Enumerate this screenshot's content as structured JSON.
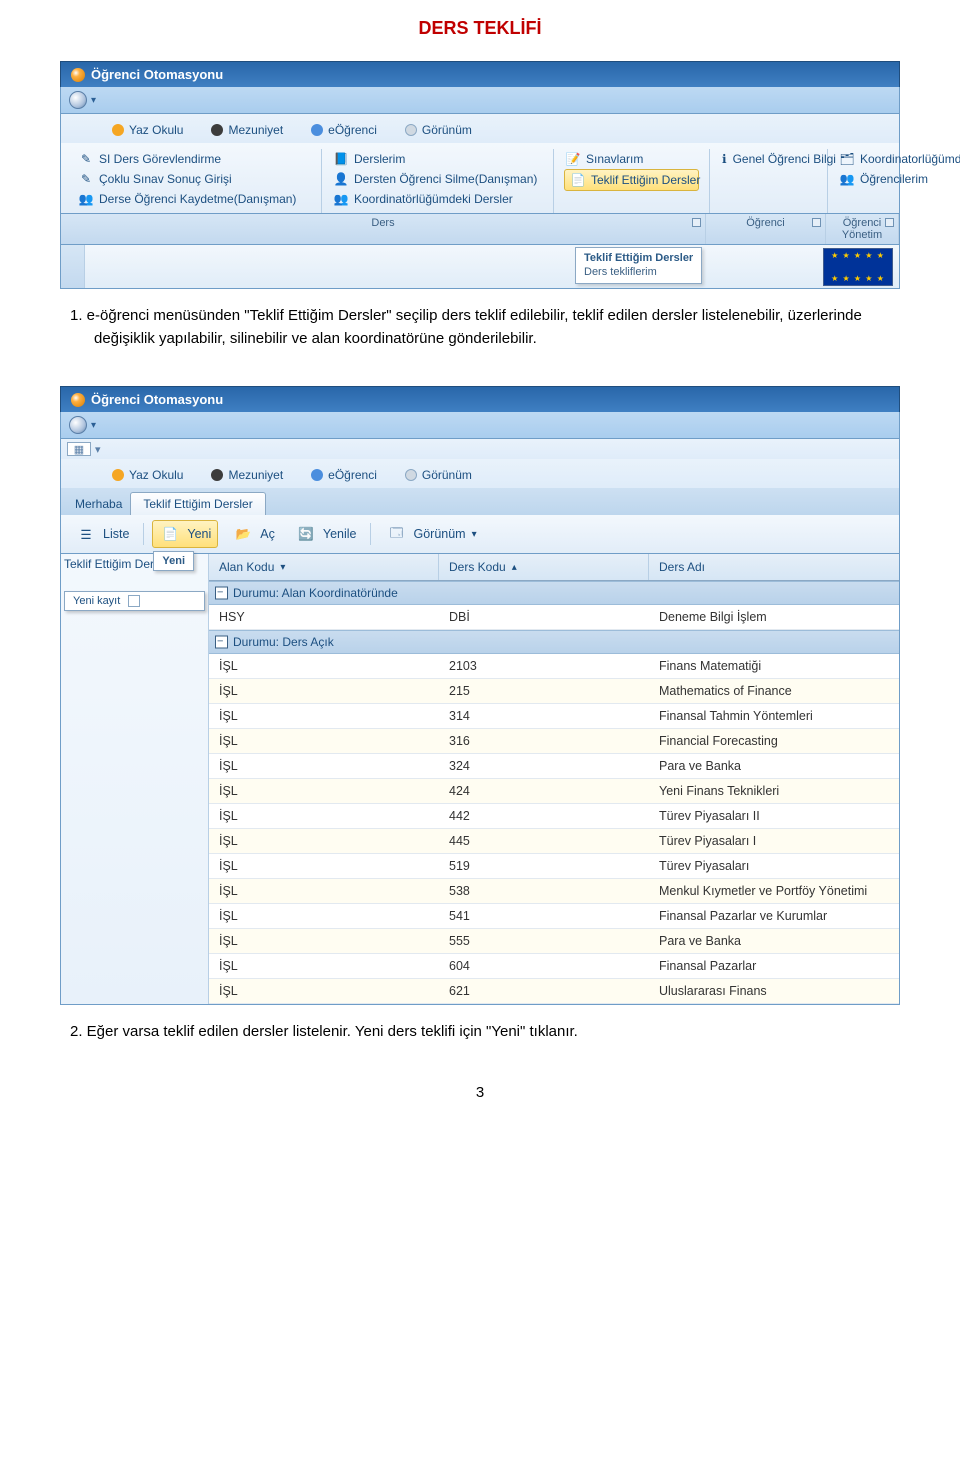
{
  "doc_title": "DERS TEKLİFİ",
  "app_title": "Öğrenci Otomasyonu",
  "shot1": {
    "tabs": [
      {
        "label": "Yaz Okulu",
        "color": "#f5a623"
      },
      {
        "label": "Mezuniyet",
        "color": "#3c3c3c"
      },
      {
        "label": "eÖğrenci",
        "color": "#4b8ede"
      },
      {
        "label": "Görünüm",
        "color": "#d0d9e2"
      }
    ],
    "groups": {
      "ders": [
        "SI Ders Görevlendirme",
        "Çoklu Sınav Sonuç Girişi",
        "Derse Öğrenci Kaydetme(Danışman)"
      ],
      "ders2": [
        "Derslerim",
        "Dersten Öğrenci Silme(Danışman)",
        "Koordinatörlüğümdeki Dersler"
      ],
      "mid": [
        "Sınavlarım",
        "Teklif Ettiğim Dersler"
      ],
      "ogr": [
        "Genel Öğrenci Bilgi"
      ],
      "yon": [
        "Koordinatorlüğümdeki Program(lar)",
        "Öğrencilerim"
      ]
    },
    "group_labels": [
      "Ders",
      "Öğrenci",
      "Öğrenci Yönetim"
    ],
    "tooltip": {
      "title": "Teklif Ettiğim Dersler",
      "sub": "Ders tekliflerim"
    }
  },
  "explain1": "1.   e-öğrenci  menüsünden \"Teklif Ettiğim Dersler\" seçilip ders teklif edilebilir, teklif edilen dersler listelenebilir,  üzerlerinde değişiklik yapılabilir, silinebilir ve alan koordinatörüne gönderilebilir.",
  "shot2": {
    "tabs": [
      {
        "label": "Yaz Okulu",
        "color": "#f5a623"
      },
      {
        "label": "Mezuniyet",
        "color": "#3c3c3c"
      },
      {
        "label": "eÖğrenci",
        "color": "#4b8ede"
      },
      {
        "label": "Görünüm",
        "color": "#d0d9e2"
      }
    ],
    "hello": "Merhaba",
    "active_tab": "Teklif Ettiğim Dersler",
    "toolbar": {
      "liste": "Liste",
      "yeni": "Yeni",
      "ac": "Aç",
      "yenile": "Yenile",
      "gorunum": "Görünüm"
    },
    "tree_label": "Teklif Ettiğim Derle",
    "popup": {
      "title": "Yeni",
      "sub": "Yeni kayıt"
    },
    "columns": {
      "alan": "Alan Kodu",
      "ders": "Ders Kodu",
      "adi": "Ders Adı"
    },
    "groups": [
      {
        "title": "Durumu: Alan Koordinatöründe",
        "rows": [
          {
            "alan": "HSY",
            "kod": "DBİ",
            "adi": "Deneme Bilgi İşlem"
          }
        ]
      },
      {
        "title": "Durumu: Ders Açık",
        "rows": [
          {
            "alan": "İŞL",
            "kod": "2103",
            "adi": "Finans Matematiği"
          },
          {
            "alan": "İŞL",
            "kod": "215",
            "adi": "Mathematics of Finance"
          },
          {
            "alan": "İŞL",
            "kod": "314",
            "adi": "Finansal Tahmin Yöntemleri"
          },
          {
            "alan": "İŞL",
            "kod": "316",
            "adi": "Financial Forecasting"
          },
          {
            "alan": "İŞL",
            "kod": "324",
            "adi": "Para ve Banka"
          },
          {
            "alan": "İŞL",
            "kod": "424",
            "adi": "Yeni Finans Teknikleri"
          },
          {
            "alan": "İŞL",
            "kod": "442",
            "adi": "Türev Piyasaları II"
          },
          {
            "alan": "İŞL",
            "kod": "445",
            "adi": "Türev Piyasaları I"
          },
          {
            "alan": "İŞL",
            "kod": "519",
            "adi": "Türev Piyasaları"
          },
          {
            "alan": "İŞL",
            "kod": "538",
            "adi": "Menkul Kıymetler ve Portföy Yönetimi"
          },
          {
            "alan": "İŞL",
            "kod": "541",
            "adi": "Finansal Pazarlar ve Kurumlar"
          },
          {
            "alan": "İŞL",
            "kod": "555",
            "adi": "Para ve Banka"
          },
          {
            "alan": "İŞL",
            "kod": "604",
            "adi": "Finansal Pazarlar"
          },
          {
            "alan": "İŞL",
            "kod": "621",
            "adi": "Uluslararası Finans"
          }
        ]
      }
    ]
  },
  "explain2": "2.   Eğer varsa teklif  edilen dersler listelenir. Yeni ders teklifi için \"Yeni\" tıklanır.",
  "page_number": "3"
}
